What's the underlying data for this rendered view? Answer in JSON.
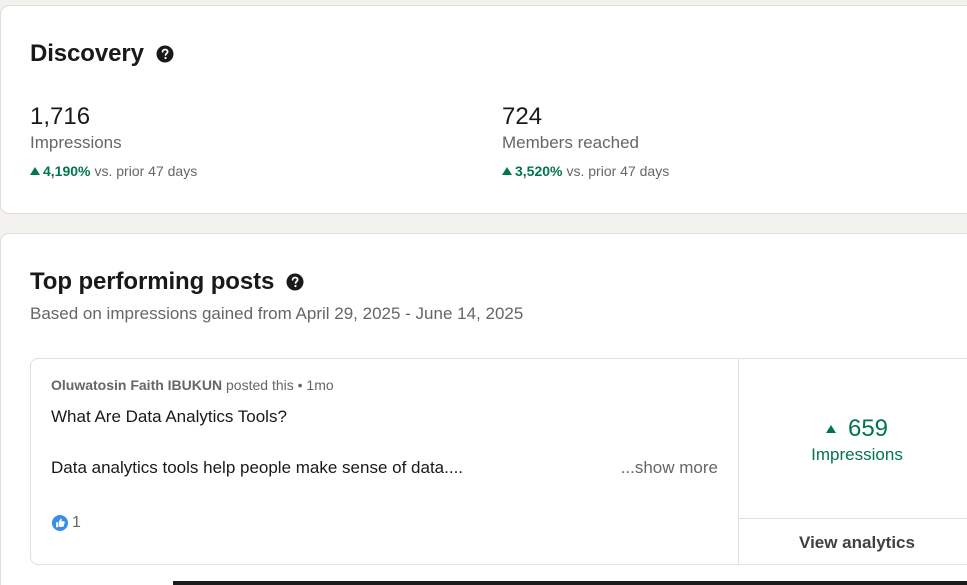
{
  "discovery": {
    "title": "Discovery",
    "impressions": {
      "value": "1,716",
      "label": "Impressions",
      "change_pct": "4,190%",
      "change_text": "vs. prior 47 days"
    },
    "members": {
      "value": "724",
      "label": "Members reached",
      "change_pct": "3,520%",
      "change_text": "vs. prior 47 days"
    }
  },
  "top_posts": {
    "title": "Top performing posts",
    "subtitle": "Based on impressions gained from April 29, 2025 - June 14, 2025",
    "post": {
      "author": "Oluwatosin Faith IBUKUN",
      "meta": " posted this • 1mo",
      "title": "What Are Data Analytics Tools?",
      "body": "Data analytics tools help people make sense of data....",
      "show_more": "...show more",
      "reaction_count": "1",
      "impressions_value": "659",
      "impressions_label": "Impressions",
      "view_analytics": "View analytics"
    }
  },
  "icons": {
    "help": "question-circle-icon",
    "trend": "triangle-up-icon",
    "like": "like-reaction-icon"
  },
  "colors": {
    "positive": "#01754f",
    "background": "#f4f2ee",
    "card": "#ffffff",
    "like": "#378fe9"
  }
}
